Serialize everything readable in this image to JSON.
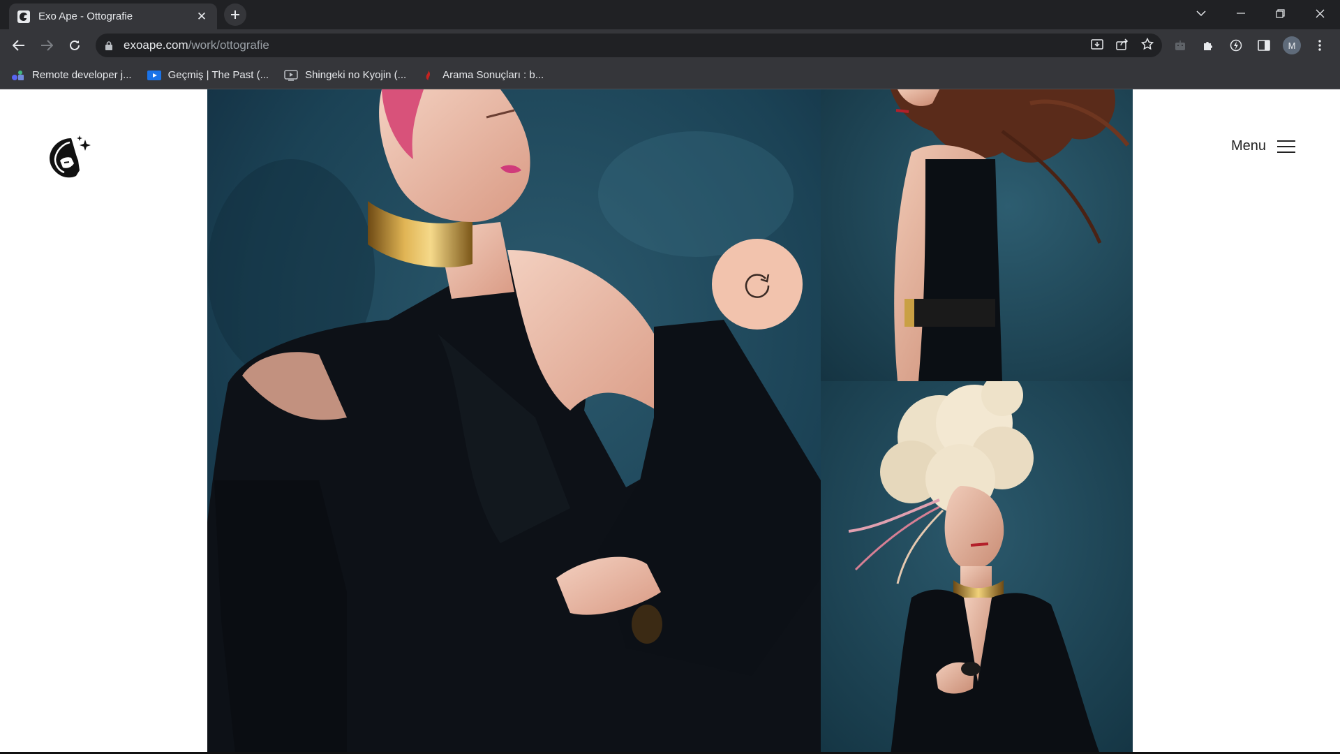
{
  "browser": {
    "tab_title": "Exo Ape - Ottografie",
    "url_host": "exoape.com",
    "url_path": "/work/ottografie",
    "profile_initial": "M",
    "bookmarks": [
      {
        "label": "Remote developer j...",
        "icon": "bookmark-apps-icon"
      },
      {
        "label": "Geçmiş | The Past (...",
        "icon": "bookmark-video-icon"
      },
      {
        "label": "Shingeki no Kyojin (...",
        "icon": "bookmark-tv-icon"
      },
      {
        "label": "Arama Sonuçları : b...",
        "icon": "bookmark-site-icon"
      }
    ]
  },
  "site": {
    "menu_label": "Menu",
    "logo_icon": "exo-ape-logo-icon",
    "rotate_icon": "rotate-icon",
    "accent_color": "#f2c3ad",
    "backdrop_color": "#17394a"
  },
  "gallery": {
    "images": [
      {
        "name": "model-pink-hair-gold-collar"
      },
      {
        "name": "model-flowing-red-hair"
      },
      {
        "name": "model-blonde-curly-hair"
      }
    ]
  }
}
